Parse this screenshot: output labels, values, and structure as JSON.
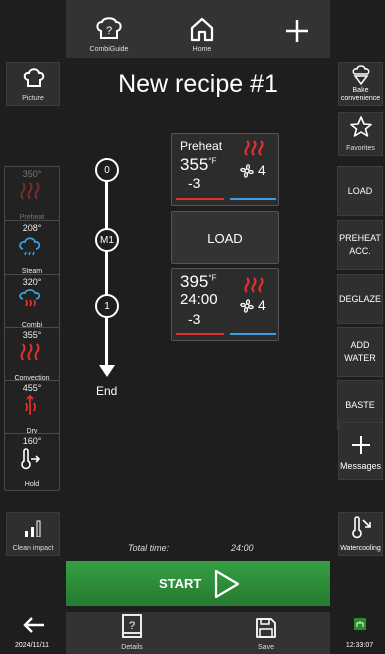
{
  "top_bar": {
    "combiguide_label": "CombiGuide",
    "home_label": "Home"
  },
  "title": "New recipe #1",
  "left": {
    "picture_label": "Picture",
    "clean_label": "Clean impact"
  },
  "modes": [
    {
      "temp": "350°",
      "label": "Preheat",
      "icon": "preheat-heat-icon",
      "disabled": true
    },
    {
      "temp": "208°",
      "label": "Steam",
      "icon": "steam-icon"
    },
    {
      "temp": "320°",
      "label": "Combi",
      "icon": "combi-icon"
    },
    {
      "temp": "355°",
      "label": "Convection",
      "icon": "convection-heat-icon"
    },
    {
      "temp": "455°",
      "label": "Dry",
      "icon": "dry-icon"
    },
    {
      "temp": "160°",
      "label": "Hold",
      "icon": "hold-thermometer-icon"
    }
  ],
  "timeline": {
    "nodes": [
      "0",
      "M1",
      "1"
    ],
    "end_label": "End"
  },
  "steps": {
    "preheat": {
      "title": "Preheat",
      "temp": "355",
      "unit": "°F",
      "value": "-3",
      "fan": "4"
    },
    "load_label": "LOAD",
    "step1": {
      "temp": "395",
      "unit": "°F",
      "time": "24:00",
      "value": "-3",
      "fan": "4"
    }
  },
  "right": {
    "bake_label": "Bake convenience",
    "favorites_label": "Favorites",
    "actions": [
      "LOAD",
      "PREHEAT ACC.",
      "DEGLAZE",
      "ADD WATER",
      "BASTE"
    ],
    "messages_label": "Messages",
    "watercooling_label": "Watercooling"
  },
  "total": {
    "label": "Total time:",
    "value": "24:00"
  },
  "start_label": "START",
  "bottom": {
    "date": "2024/11/11",
    "details_label": "Details",
    "save_label": "Save",
    "time": "12:33:07"
  },
  "colors": {
    "heat": "#e03030",
    "steam": "#3aa0e0",
    "start_green": "#2e8b3a"
  }
}
